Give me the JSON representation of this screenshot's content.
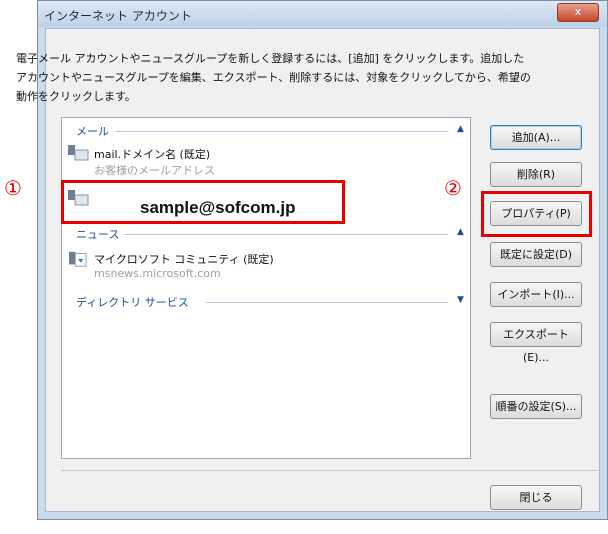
{
  "window": {
    "title": "インターネット アカウント",
    "close_label": "x"
  },
  "description": "電子メール アカウントやニュースグループを新しく登録するには、[追加] をクリックします。追加した\nアカウントやニュースグループを編集、エクスポート、削除するには、対象をクリックしてから、希望の\n動作をクリックします。",
  "groups": {
    "mail": "メール",
    "news": "ニュース",
    "directory": "ディレクトリ サービス"
  },
  "accounts": {
    "mail_account_name": "mail.ドメイン名 (既定)",
    "mail_account_email": "お客様のメールアドレス",
    "selected_email": "sample@sofcom.jp",
    "news_account_name": "マイクロソフト コミュニティ (既定)",
    "news_account_server": "msnews.microsoft.com"
  },
  "buttons": {
    "add": "追加(A)...",
    "delete": "削除(R)",
    "properties": "プロパティ(P)",
    "set_default": "既定に設定(D)",
    "import": "インポート(I)...",
    "export": "エクスポート(E)...",
    "order": "順番の設定(S)...",
    "close": "閉じる"
  },
  "annotations": {
    "marker_1": "①",
    "marker_2": "②"
  },
  "colors": {
    "highlight": "#e60000",
    "group_header": "#1f4f9a"
  }
}
